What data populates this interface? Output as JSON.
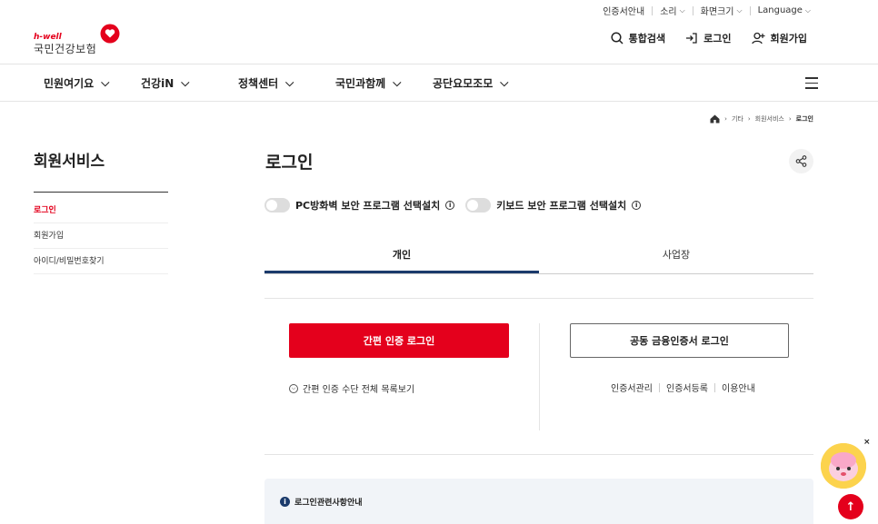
{
  "util_bar": {
    "cert_guide": "인증서안내",
    "sound": "소리",
    "screen_size": "화면크기",
    "language": "Language"
  },
  "logo": {
    "sub": "h-well",
    "main": "국민건강보험"
  },
  "header_actions": {
    "search": "통합검색",
    "login": "로그인",
    "signup": "회원가입"
  },
  "nav": {
    "items": [
      "민원여기요",
      "건강iN",
      "정책센터",
      "국민과함께",
      "공단요모조모"
    ]
  },
  "breadcrumb": {
    "items": [
      "기타",
      "회원서비스",
      "로그인"
    ]
  },
  "side": {
    "title": "회원서비스",
    "items": [
      "로그인",
      "회원가입",
      "아이디/비밀번호찾기"
    ]
  },
  "main": {
    "title": "로그인",
    "toggles": {
      "pc_firewall": "PC방화벽 보안 프로그램 선택설치",
      "keyboard": "키보드 보안 프로그램 선택설치"
    },
    "tabs": [
      "개인",
      "사업장"
    ],
    "simple_login_button": "간편 인증 로그인",
    "cert_login_button": "공동 금융인증서 로그인",
    "simple_list_link": "간편 인증 수단 전체 목록보기",
    "cert_links": [
      "인증서관리",
      "인증서등록",
      "이용안내"
    ],
    "notice_title": "로그인관련사항안내"
  },
  "colors": {
    "brand_red": "#e4001c",
    "tab_active": "#1a3a6b"
  }
}
